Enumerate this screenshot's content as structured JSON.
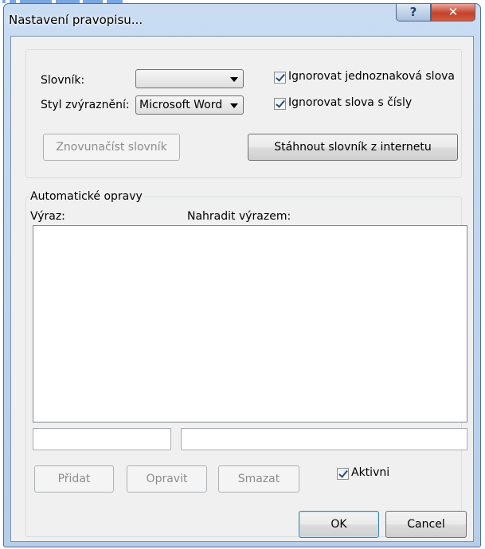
{
  "window": {
    "title": "Nastavení pravopisu...",
    "help_glyph": "?",
    "close_glyph": "✕"
  },
  "settings": {
    "dictionary_label": "Slovník:",
    "dictionary_value": "",
    "highlight_label": "Styl zvýraznění:",
    "highlight_value": "Microsoft Word",
    "ignore_single_letter_label": "Ignorovat jednoznaková slova",
    "ignore_single_letter_checked": true,
    "ignore_numbers_label": "Ignorovat slova s čísly",
    "ignore_numbers_checked": true,
    "reload_button": "Znovunačíst slovník",
    "download_button": "Stáhnout slovník z internetu"
  },
  "autocorrect": {
    "group_label": "Automatické opravy",
    "column_expression": "Výraz:",
    "column_replace": "Nahradit výrazem:",
    "rows": [],
    "expression_input": "",
    "replace_input": "",
    "add_button": "Přidat",
    "edit_button": "Opravit",
    "delete_button": "Smazat",
    "active_label": "Aktivni",
    "active_checked": true
  },
  "footer": {
    "ok_button": "OK",
    "cancel_button": "Cancel"
  },
  "colors": {
    "frame": "#b7cee9",
    "close_button": "#c5422d",
    "dialog_bg": "#f0f0f0"
  }
}
